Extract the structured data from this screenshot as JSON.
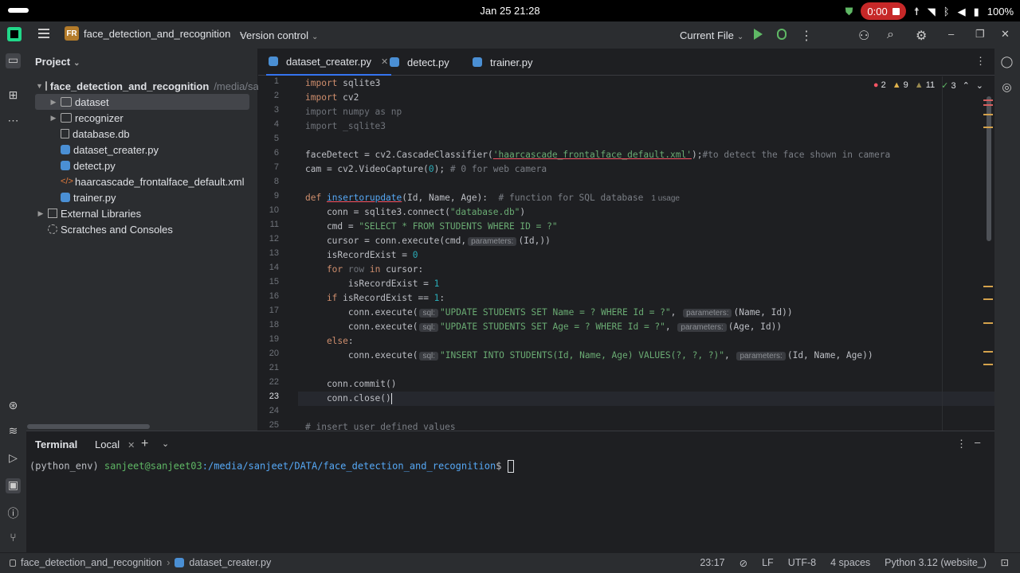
{
  "os": {
    "time": "Jan 25  21:28",
    "recording": "0:00",
    "battery": "100%"
  },
  "titlebar": {
    "project_badge": "FR",
    "project_name": "face_detection_and_recognition",
    "vcs": "Version control",
    "run_config": "Current File"
  },
  "project": {
    "header": "Project",
    "tree": [
      {
        "label": "face_detection_and_recognition",
        "extra": "/media/sa",
        "type": "folder",
        "depth": 0,
        "arrow": "open"
      },
      {
        "label": "dataset",
        "type": "folder",
        "depth": 1,
        "arrow": "closed",
        "selected": true
      },
      {
        "label": "recognizer",
        "type": "folder",
        "depth": 1,
        "arrow": "closed"
      },
      {
        "label": "database.db",
        "type": "db",
        "depth": 1
      },
      {
        "label": "dataset_creater.py",
        "type": "py",
        "depth": 1
      },
      {
        "label": "detect.py",
        "type": "py",
        "depth": 1
      },
      {
        "label": "haarcascade_frontalface_default.xml",
        "type": "xml",
        "depth": 1
      },
      {
        "label": "trainer.py",
        "type": "py",
        "depth": 1
      },
      {
        "label": "External Libraries",
        "type": "lib",
        "depth": 0,
        "arrow": "closed"
      },
      {
        "label": "Scratches and Consoles",
        "type": "scratch",
        "depth": 0
      }
    ]
  },
  "editor": {
    "tabs": [
      {
        "label": "dataset_creater.py",
        "active": true
      },
      {
        "label": "detect.py"
      },
      {
        "label": "trainer.py"
      }
    ],
    "inspections": {
      "errors": "2",
      "warnings": "9",
      "weak": "11",
      "typos": "3"
    },
    "current_line": 23,
    "lines": [
      "1",
      "2",
      "3",
      "4",
      "5",
      "6",
      "7",
      "8",
      "9",
      "10",
      "11",
      "12",
      "13",
      "14",
      "15",
      "16",
      "17",
      "18",
      "19",
      "20",
      "21",
      "22",
      "23",
      "24",
      "25"
    ],
    "code": {
      "l1a": "import",
      "l1b": " sqlite3",
      "l2a": "import",
      "l2b": " cv2",
      "l3": "import numpy as np",
      "l3n": "numpy",
      "l4": "import _sqlite3",
      "l6a": "faceDetect = cv2.CascadeClassifier(",
      "l6s": "'haarcascade_frontalface_default.xml'",
      "l6b": ");",
      "l6c": "#to detect the face shown in camera",
      "l7a": "cam = cv2.VideoCapture(",
      "l7n": "0",
      "l7b": ");",
      "l7c": " # 0 for web camera",
      "l9k": "def",
      "l9f": "insertorupdate",
      "l9b": "(Id, Name, Age):",
      "l9c": "  # function for SQL database",
      "l9u": "1 usage",
      "l10a": "    conn = sqlite3.connect(",
      "l10s": "\"database.db\"",
      "l10b": ")",
      "l11a": "    cmd = ",
      "l11s": "\"SELECT * FROM STUDENTS WHERE ID = ?\"",
      "l12a": "    cursor = conn.execute(cmd,",
      "l12h": "parameters:",
      "l12b": "(Id,))",
      "l13a": "    isRecordExist = ",
      "l13n": "0",
      "l14k": "    for",
      "l14r": " row",
      "l14i": " in",
      "l14b": " cursor:",
      "l15a": "        isRecordExist = ",
      "l15n": "1",
      "l16k": "    if",
      "l16b": " isRecordExist == ",
      "l16n": "1",
      "l16c": ":",
      "l17a": "        conn.execute(",
      "l17h": "sql:",
      "l17s": "\"UPDATE STUDENTS SET Name = ? WHERE Id = ?\"",
      "l17h2": "parameters:",
      "l17b": "(Name, Id))",
      "l18a": "        conn.execute(",
      "l18h": "sql:",
      "l18s": "\"UPDATE STUDENTS SET Age = ? WHERE Id = ?\"",
      "l18h2": "parameters:",
      "l18b": "(Age, Id))",
      "l19k": "    else",
      "l19b": ":",
      "l20a": "        conn.execute(",
      "l20h": "sql:",
      "l20s": "\"INSERT INTO STUDENTS(Id, Name, Age) VALUES(?, ?, ?)\"",
      "l20h2": "parameters:",
      "l20b": "(Id, Name, Age))",
      "l22": "    conn.commit()",
      "l23": "    conn.close()",
      "l25": "# insert user defined values"
    }
  },
  "terminal": {
    "title": "Terminal",
    "tab": "Local",
    "env": "(python_env) ",
    "user": "sanjeet@sanjeet03",
    "path": ":/media/sanjeet/DATA/face_detection_and_recognition",
    "suffix": "$ "
  },
  "statusbar": {
    "crumb_project": "face_detection_and_recognition",
    "crumb_file": "dataset_creater.py",
    "position": "23:17",
    "line_sep": "LF",
    "encoding": "UTF-8",
    "indent": "4 spaces",
    "interpreter": "Python 3.12 (website_)"
  }
}
